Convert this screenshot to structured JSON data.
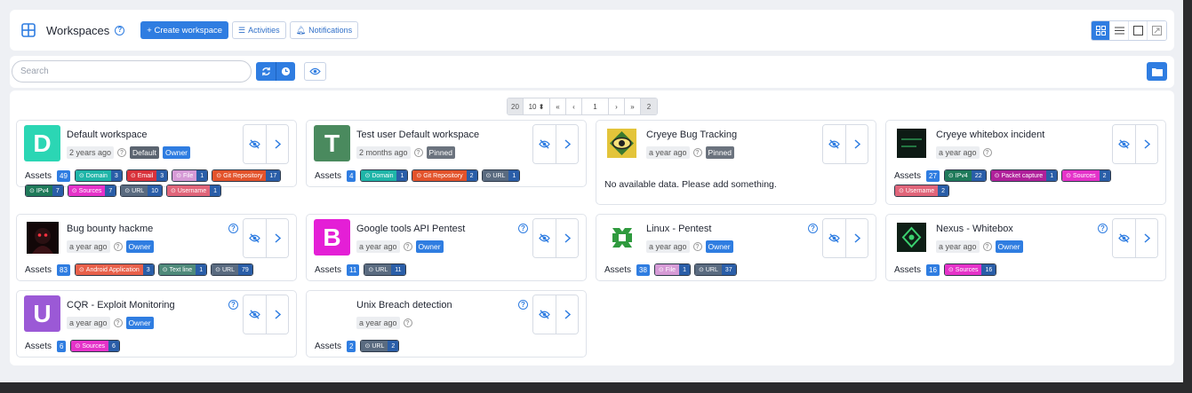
{
  "header": {
    "title": "Workspaces",
    "create_label": "+ Create workspace",
    "activities_label": "Activities",
    "notifications_label": "Notifications"
  },
  "search": {
    "placeholder": "Search"
  },
  "pagination": {
    "per_page_left": "20",
    "per_page_select": "10 ⬍",
    "first": "«",
    "prev": "‹",
    "current": "1",
    "next": "›",
    "last": "»",
    "total_pages": "2"
  },
  "labels": {
    "assets": "Assets"
  },
  "cards": [
    {
      "title": "Default workspace",
      "avatar_letter": "D",
      "avatar_color": "#2bd6b4",
      "time": "2 years ago",
      "tags": [
        "Default",
        "Owner"
      ],
      "assets_count": "49",
      "chips": [
        {
          "label": "Domain",
          "count": "3",
          "color": "#1fb5a8"
        },
        {
          "label": "Email",
          "count": "3",
          "color": "#d9323b"
        },
        {
          "label": "File",
          "count": "1",
          "color": "#d69ad6"
        },
        {
          "label": "Git Repository",
          "count": "17",
          "color": "#e3532b"
        },
        {
          "label": "IPv4",
          "count": "7",
          "color": "#1f7a5a"
        },
        {
          "label": "Sources",
          "count": "7",
          "color": "#e532c9"
        },
        {
          "label": "URL",
          "count": "10",
          "color": "#5a6b80"
        },
        {
          "label": "Username",
          "count": "1",
          "color": "#e0657a"
        }
      ]
    },
    {
      "title": "Test user Default workspace",
      "avatar_letter": "T",
      "avatar_color": "#4a8a5e",
      "time": "2 months ago",
      "tags": [
        "Pinned"
      ],
      "assets_count": "4",
      "chips": [
        {
          "label": "Domain",
          "count": "1",
          "color": "#1fb5a8"
        },
        {
          "label": "Git Repository",
          "count": "2",
          "color": "#e3532b"
        },
        {
          "label": "URL",
          "count": "1",
          "color": "#5a6b80"
        }
      ]
    },
    {
      "title": "Cryeye Bug Tracking",
      "logo": "eye-bug",
      "time": "a year ago",
      "tags": [
        "Pinned"
      ],
      "nodata": "No available data. Please add something."
    },
    {
      "title": "Cryeye whitebox incident",
      "logo": "whitebox",
      "time": "a year ago",
      "tags": [],
      "assets_count": "27",
      "chips": [
        {
          "label": "IPv4",
          "count": "22",
          "color": "#1f7a5a"
        },
        {
          "label": "Packet capture",
          "count": "1",
          "color": "#b0209a"
        },
        {
          "label": "Sources",
          "count": "2",
          "color": "#e532c9"
        },
        {
          "label": "Username",
          "count": "2",
          "color": "#e0657a"
        }
      ]
    },
    {
      "title": "Bug bounty hackme",
      "logo": "hacker",
      "time": "a year ago",
      "tags": [
        "Owner"
      ],
      "assets_count": "83",
      "chips": [
        {
          "label": "Android Application",
          "count": "3",
          "color": "#e8604a"
        },
        {
          "label": "Text line",
          "count": "1",
          "color": "#4f8a7a"
        },
        {
          "label": "URL",
          "count": "79",
          "color": "#5a6b80"
        }
      ]
    },
    {
      "title": "Google tools API Pentest",
      "avatar_letter": "B",
      "avatar_color": "#e41fd6",
      "time": "a year ago",
      "tags": [
        "Owner"
      ],
      "assets_count": "11",
      "chips": [
        {
          "label": "URL",
          "count": "11",
          "color": "#5a6b80"
        }
      ]
    },
    {
      "title": "Linux - Pentest",
      "logo": "linux",
      "time": "a year ago",
      "tags": [
        "Owner"
      ],
      "assets_count": "38",
      "chips": [
        {
          "label": "File",
          "count": "1",
          "color": "#d69ad6"
        },
        {
          "label": "URL",
          "count": "37",
          "color": "#5a6b80"
        }
      ]
    },
    {
      "title": "Nexus - Whitebox",
      "logo": "nexus",
      "time": "a year ago",
      "tags": [
        "Owner"
      ],
      "assets_count": "16",
      "chips": [
        {
          "label": "Sources",
          "count": "16",
          "color": "#e532c9"
        }
      ]
    },
    {
      "title": "CQR - Exploit Monitoring",
      "avatar_letter": "U",
      "avatar_color": "#9b59d6",
      "time": "a year ago",
      "tags": [
        "Owner"
      ],
      "assets_count": "6",
      "chips": [
        {
          "label": "Sources",
          "count": "6",
          "color": "#e532c9"
        }
      ]
    },
    {
      "title": "Unix Breach detection",
      "logo": "none",
      "time": "a year ago",
      "tags": [],
      "assets_count": "2",
      "chips": [
        {
          "label": "URL",
          "count": "2",
          "color": "#5a6b80"
        }
      ]
    }
  ]
}
